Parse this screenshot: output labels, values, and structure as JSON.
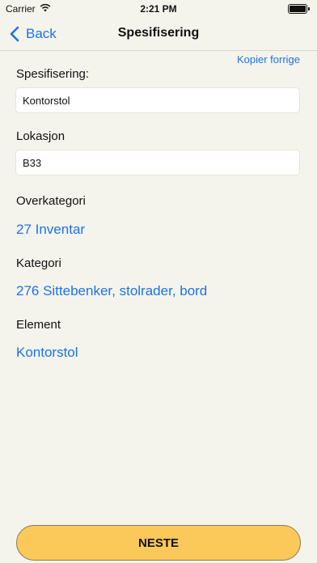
{
  "status_bar": {
    "carrier": "Carrier",
    "time": "2:21 PM"
  },
  "nav": {
    "back_label": "Back",
    "title": "Spesifisering"
  },
  "form": {
    "copy_previous_label": "Kopier forrige",
    "spec_label": "Spesifisering:",
    "spec_value": "Kontorstol",
    "location_label": "Lokasjon",
    "location_value": "B33",
    "main_category_label": "Overkategori",
    "main_category_value": "27 Inventar",
    "category_label": "Kategori",
    "category_value": "276 Sittebenker, stolrader, bord",
    "element_label": "Element",
    "element_value": "Kontorstol"
  },
  "footer": {
    "next_label": "NESTE"
  },
  "colors": {
    "accent": "#1a73e8",
    "button": "#fbc85a",
    "background": "#f5f4ec"
  }
}
